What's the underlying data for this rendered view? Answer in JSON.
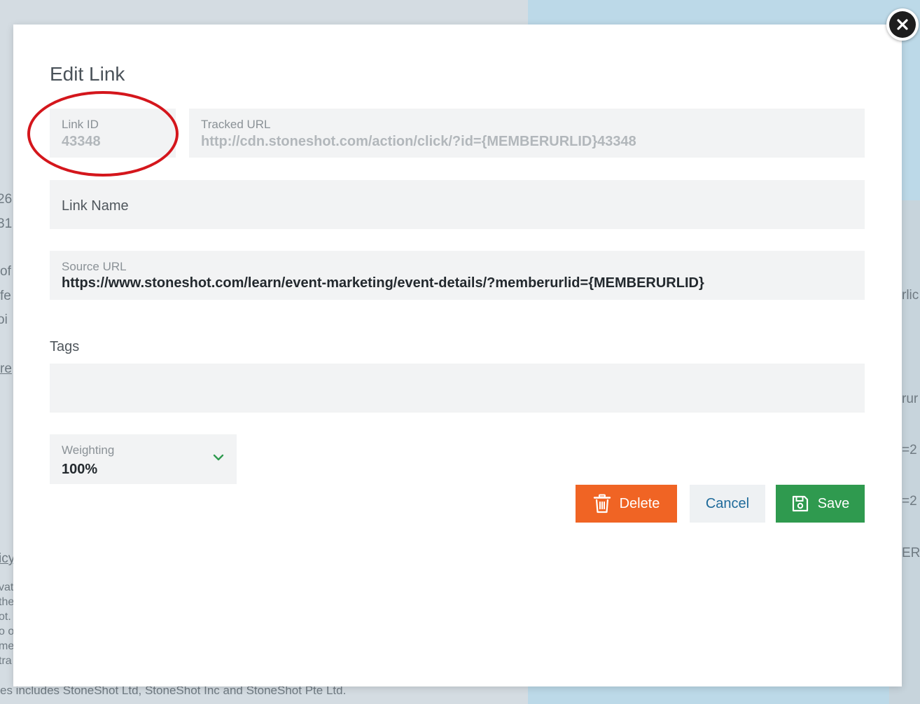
{
  "background": {
    "fragments_left": [
      "26",
      "31",
      "of",
      "fe",
      "oi",
      "re",
      "icy",
      "vat",
      "the",
      "ot.",
      "o o",
      "me",
      "tra"
    ],
    "fragments_right": [
      "rlic",
      "rur",
      "=2",
      "=2",
      "ERU"
    ],
    "footer": "es includes StoneShot Ltd, StoneShot Inc and StoneShot Pte Ltd."
  },
  "modal": {
    "title": "Edit Link",
    "link_id": {
      "label": "Link ID",
      "value": "43348"
    },
    "tracked_url": {
      "label": "Tracked URL",
      "value": "http://cdn.stoneshot.com/action/click/?id={MEMBERURLID}43348"
    },
    "link_name": {
      "label": "Link Name",
      "value": ""
    },
    "source_url": {
      "label": "Source URL",
      "value": "https://www.stoneshot.com/learn/event-marketing/event-details/?memberurlid={MEMBERURLID}"
    },
    "tags": {
      "label": "Tags",
      "value": ""
    },
    "weighting": {
      "label": "Weighting",
      "value": "100%"
    },
    "buttons": {
      "delete": "Delete",
      "cancel": "Cancel",
      "save": "Save"
    }
  },
  "colors": {
    "delete": "#f06424",
    "save": "#2f9a4f",
    "cancel_text": "#1e6a9a",
    "annotation": "#d4161c",
    "chevron": "#2f9a4f"
  },
  "icons": {
    "delete": "trash-icon",
    "save": "floppy-disk-icon",
    "close": "close-icon",
    "weighting": "chevron-down-icon"
  }
}
